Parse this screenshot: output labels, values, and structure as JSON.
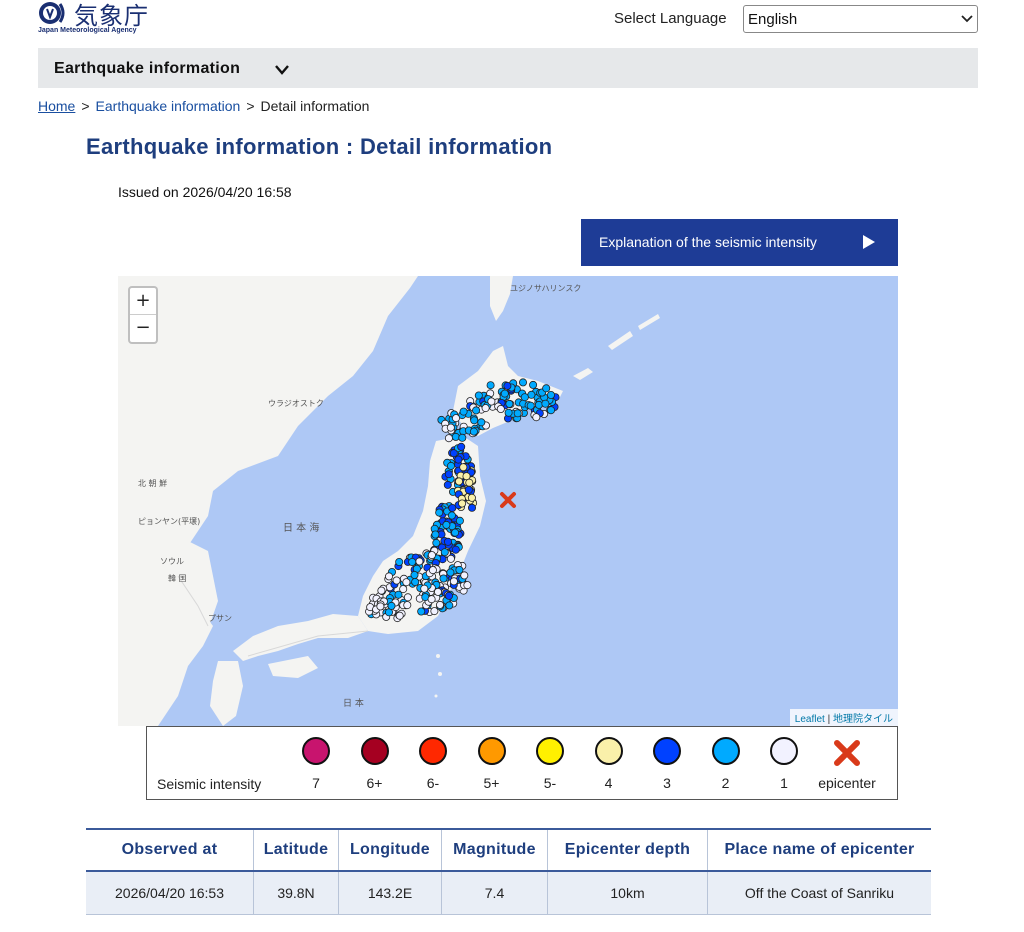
{
  "header": {
    "logo_text": "気象庁",
    "logo_subtitle": "Japan Meteorological Agency",
    "language_label": "Select Language",
    "language_selected": "English"
  },
  "nav": {
    "title": "Earthquake information"
  },
  "breadcrumb": {
    "home": "Home",
    "section": "Earthquake information",
    "current": "Detail information",
    "separator": ">"
  },
  "page": {
    "title": "Earthquake information : Detail information",
    "issued": "Issued on 2026/04/20 16:58"
  },
  "explanation_button": {
    "label": "Explanation of the seismic intensity"
  },
  "map": {
    "zoom_in": "+",
    "zoom_out": "−",
    "attribution_leaflet": "Leaflet",
    "attribution_separator": "|",
    "attribution_tiles": "地理院タイル",
    "labels": {
      "vladivostok": "ウラジオストク",
      "yuzhno": "ユジノサハリンスク",
      "sea_of_japan": "日 本 海",
      "nihon": "日 本",
      "pyongyang": "ピョンヤン(平壌)",
      "seoul": "ソウル",
      "busan": "プサン",
      "north_korea": "北 朝 鮮",
      "korea": "韓 国"
    }
  },
  "legend": {
    "title": "Seismic intensity",
    "items": [
      {
        "label": "7",
        "color": "#c8146e"
      },
      {
        "label": "6+",
        "color": "#a50021"
      },
      {
        "label": "6-",
        "color": "#ff2800"
      },
      {
        "label": "5+",
        "color": "#ff9900"
      },
      {
        "label": "5-",
        "color": "#fff000"
      },
      {
        "label": "4",
        "color": "#faf0aa"
      },
      {
        "label": "3",
        "color": "#0041ff"
      },
      {
        "label": "2",
        "color": "#00aaff"
      },
      {
        "label": "1",
        "color": "#f2f2ff"
      }
    ],
    "epicenter_label": "epicenter",
    "epicenter_color": "#d93a1a"
  },
  "observation_table": {
    "headers": [
      "Observed at",
      "Latitude",
      "Longitude",
      "Magnitude",
      "Epicenter depth",
      "Place name of epicenter"
    ],
    "row": [
      "2026/04/20 16:53",
      "39.8N",
      "143.2E",
      "7.4",
      "10km",
      "Off the Coast of Sanriku"
    ]
  }
}
